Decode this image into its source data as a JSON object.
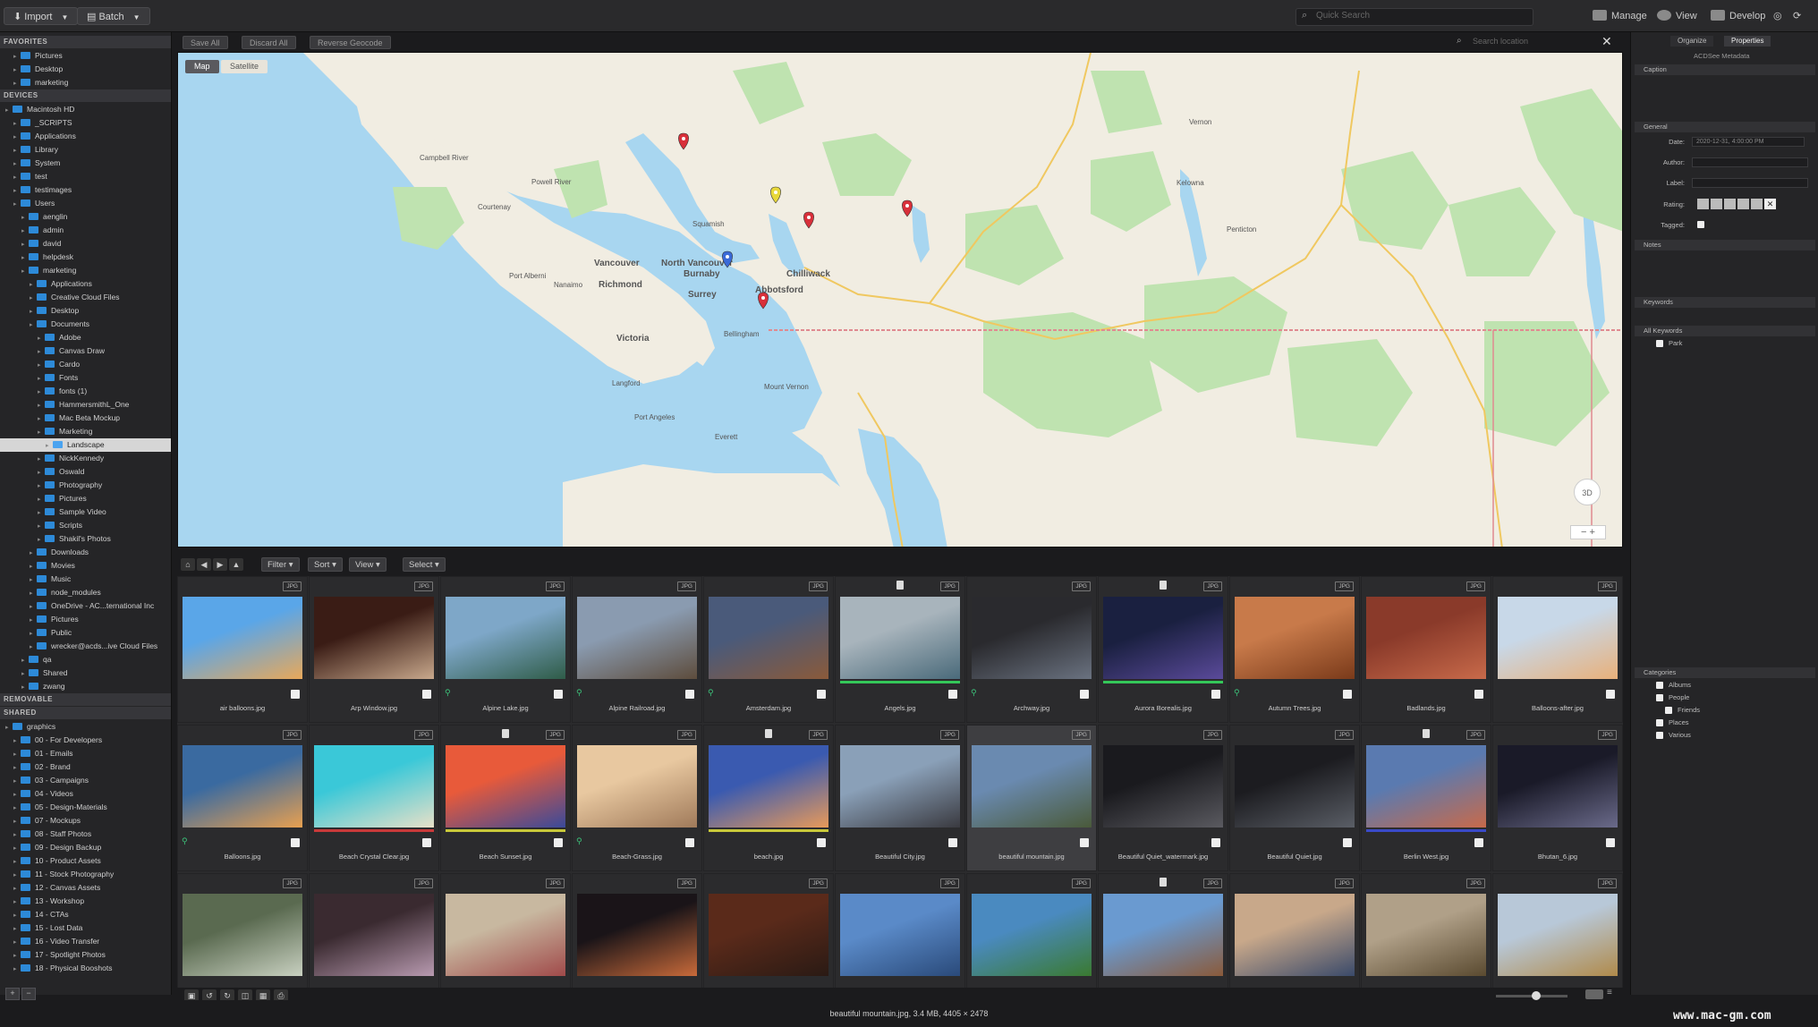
{
  "toolbar": {
    "import_label": "Import",
    "batch_label": "Batch",
    "quick_search_placeholder": "Quick Search",
    "manage_label": "Manage",
    "view_label": "View",
    "develop_label": "Develop"
  },
  "left_panel": {
    "sections": {
      "favorites": "FAVORITES",
      "devices": "DEVICES",
      "removable": "REMOVABLE",
      "shared": "SHARED"
    },
    "favorites": [
      "Pictures",
      "Desktop",
      "marketing"
    ],
    "devices": [
      {
        "label": "Macintosh HD",
        "depth": 0
      },
      {
        "label": "_SCRIPTS",
        "depth": 1
      },
      {
        "label": "Applications",
        "depth": 1
      },
      {
        "label": "Library",
        "depth": 1
      },
      {
        "label": "System",
        "depth": 1
      },
      {
        "label": "test",
        "depth": 1
      },
      {
        "label": "testimages",
        "depth": 1
      },
      {
        "label": "Users",
        "depth": 1
      },
      {
        "label": "aenglin",
        "depth": 2
      },
      {
        "label": "admin",
        "depth": 2
      },
      {
        "label": "david",
        "depth": 2
      },
      {
        "label": "helpdesk",
        "depth": 2
      },
      {
        "label": "marketing",
        "depth": 2
      },
      {
        "label": "Applications",
        "depth": 3
      },
      {
        "label": "Creative Cloud Files",
        "depth": 3
      },
      {
        "label": "Desktop",
        "depth": 3
      },
      {
        "label": "Documents",
        "depth": 3
      },
      {
        "label": "Adobe",
        "depth": 4
      },
      {
        "label": "Canvas Draw",
        "depth": 4
      },
      {
        "label": "Cardo",
        "depth": 4
      },
      {
        "label": "Fonts",
        "depth": 4
      },
      {
        "label": "fonts (1)",
        "depth": 4
      },
      {
        "label": "HammersmithL_One",
        "depth": 4
      },
      {
        "label": "Mac Beta Mockup",
        "depth": 4
      },
      {
        "label": "Marketing",
        "depth": 4
      },
      {
        "label": "Landscape",
        "depth": 5,
        "selected": true
      },
      {
        "label": "NickKennedy",
        "depth": 4
      },
      {
        "label": "Oswald",
        "depth": 4
      },
      {
        "label": "Photography",
        "depth": 4
      },
      {
        "label": "Pictures",
        "depth": 4
      },
      {
        "label": "Sample Video",
        "depth": 4
      },
      {
        "label": "Scripts",
        "depth": 4
      },
      {
        "label": "Shakil's Photos",
        "depth": 4
      },
      {
        "label": "Downloads",
        "depth": 3
      },
      {
        "label": "Movies",
        "depth": 3
      },
      {
        "label": "Music",
        "depth": 3
      },
      {
        "label": "node_modules",
        "depth": 3
      },
      {
        "label": "OneDrive - AC...ternational Inc",
        "depth": 3
      },
      {
        "label": "Pictures",
        "depth": 3
      },
      {
        "label": "Public",
        "depth": 3
      },
      {
        "label": "wrecker@acds...ive Cloud Files",
        "depth": 3
      },
      {
        "label": "qa",
        "depth": 2
      },
      {
        "label": "Shared",
        "depth": 2
      },
      {
        "label": "zwang",
        "depth": 2
      }
    ],
    "shared": [
      {
        "label": "graphics",
        "depth": 0
      },
      {
        "label": "00 - For Developers",
        "depth": 1
      },
      {
        "label": "01 - Emails",
        "depth": 1
      },
      {
        "label": "02 - Brand",
        "depth": 1
      },
      {
        "label": "03 - Campaigns",
        "depth": 1
      },
      {
        "label": "04 - Videos",
        "depth": 1
      },
      {
        "label": "05 - Design-Materials",
        "depth": 1
      },
      {
        "label": "07 - Mockups",
        "depth": 1
      },
      {
        "label": "08 - Staff Photos",
        "depth": 1
      },
      {
        "label": "09 - Design Backup",
        "depth": 1
      },
      {
        "label": "10 - Product Assets",
        "depth": 1
      },
      {
        "label": "11 - Stock Photography",
        "depth": 1
      },
      {
        "label": "12 - Canvas Assets",
        "depth": 1
      },
      {
        "label": "13 - Workshop",
        "depth": 1
      },
      {
        "label": "14 - CTAs",
        "depth": 1
      },
      {
        "label": "15 - Lost Data",
        "depth": 1
      },
      {
        "label": "16 - Video Transfer",
        "depth": 1
      },
      {
        "label": "17 - Spotlight Photos",
        "depth": 1
      },
      {
        "label": "18 - Physical Booshots",
        "depth": 1
      }
    ]
  },
  "map_toolbar": {
    "save_all": "Save All",
    "discard_all": "Discard All",
    "reverse_geocode": "Reverse Geocode",
    "search_placeholder": "Search location"
  },
  "map": {
    "tab_map": "Map",
    "tab_satellite": "Satellite",
    "labels": [
      {
        "text": "Vancouver"
      },
      {
        "text": "North Vancouver"
      },
      {
        "text": "Burnaby"
      },
      {
        "text": "Richmond"
      },
      {
        "text": "Surrey"
      },
      {
        "text": "Abbotsford"
      },
      {
        "text": "Chilliwack"
      },
      {
        "text": "Victoria"
      },
      {
        "text": "Nanaimo"
      },
      {
        "text": "Port Alberni"
      },
      {
        "text": "Campbell River"
      },
      {
        "text": "Powell River"
      },
      {
        "text": "Kelowna"
      },
      {
        "text": "Bellingham"
      },
      {
        "text": "Everett"
      },
      {
        "text": "Mount Vernon"
      },
      {
        "text": "Port Angeles"
      },
      {
        "text": "Penticton"
      },
      {
        "text": "Vernon"
      },
      {
        "text": "Courtenay"
      },
      {
        "text": "Squamish"
      },
      {
        "text": "Langford"
      }
    ],
    "compass_label": "3D"
  },
  "film_toolbar": {
    "filter": "Filter",
    "sort": "Sort",
    "view": "View",
    "select": "Select"
  },
  "thumbnails": [
    {
      "name": "air balloons.jpg",
      "badge": "JPG",
      "colors": [
        "#5aa6e8",
        "#e8a85a"
      ]
    },
    {
      "name": "Arp Window.jpg",
      "badge": "JPG",
      "colors": [
        "#3a1c15",
        "#c8a88c"
      ]
    },
    {
      "name": "Alpine Lake.jpg",
      "badge": "JPG",
      "colors": [
        "#7ea7c8",
        "#2f5c48"
      ],
      "pin": true
    },
    {
      "name": "Alpine Railroad.jpg",
      "badge": "JPG",
      "colors": [
        "#8a9bb0",
        "#5d4c3c"
      ],
      "pin": true
    },
    {
      "name": "Amsterdam.jpg",
      "badge": "JPG",
      "colors": [
        "#4a5a7a",
        "#8a5a3a"
      ],
      "pin": true
    },
    {
      "name": "Angels.jpg",
      "badge": "JPG",
      "colors": [
        "#a8b4bc",
        "#4a6a7a"
      ],
      "page": true,
      "bar": "#34c759"
    },
    {
      "name": "Archway.jpg",
      "badge": "JPG",
      "colors": [
        "#2a2a2e",
        "#6a7280"
      ],
      "pin": true
    },
    {
      "name": "Aurora Borealis.jpg",
      "badge": "JPG",
      "colors": [
        "#1a2040",
        "#5a4a9a"
      ],
      "page": true,
      "bar": "#34c759"
    },
    {
      "name": "Autumn Trees.jpg",
      "badge": "JPG",
      "colors": [
        "#c87a4a",
        "#7a3a1a"
      ],
      "pin": true
    },
    {
      "name": "Badlands.jpg",
      "badge": "JPG",
      "colors": [
        "#8a3a2a",
        "#c86a4a"
      ]
    },
    {
      "name": "Balloons-after.jpg",
      "badge": "JPG",
      "colors": [
        "#c8d8e8",
        "#e8b07a"
      ]
    },
    {
      "name": "Balloons.jpg",
      "badge": "JPG",
      "colors": [
        "#3a6aa0",
        "#e8a050"
      ],
      "pin": true
    },
    {
      "name": "Beach Crystal Clear.jpg",
      "badge": "JPG",
      "colors": [
        "#3ac8d8",
        "#e8e0c8"
      ],
      "bar": "#c83a3a"
    },
    {
      "name": "Beach Sunset.jpg",
      "badge": "JPG",
      "colors": [
        "#e85a3a",
        "#3a4a9a"
      ],
      "page": true,
      "bar": "#c8c83a"
    },
    {
      "name": "Beach-Grass.jpg",
      "badge": "JPG",
      "colors": [
        "#e8c8a0",
        "#a07a5a"
      ],
      "pin": true
    },
    {
      "name": "beach.jpg",
      "badge": "JPG",
      "colors": [
        "#3a5ab0",
        "#e89a5a"
      ],
      "page": true,
      "bar": "#c8c83a"
    },
    {
      "name": "Beautiful City.jpg",
      "badge": "JPG",
      "colors": [
        "#8aa0b8",
        "#3a3a40"
      ]
    },
    {
      "name": "beautiful mountain.jpg",
      "badge": "JPG",
      "colors": [
        "#6a8ab0",
        "#4a5a3a"
      ],
      "selected": true
    },
    {
      "name": "Beautiful Quiet_watermark.jpg",
      "badge": "JPG",
      "colors": [
        "#1a1a1e",
        "#5a5a60"
      ]
    },
    {
      "name": "Beautiful Quiet.jpg",
      "badge": "JPG",
      "colors": [
        "#1c1c20",
        "#5a5e66"
      ]
    },
    {
      "name": "Berlin West.jpg",
      "badge": "JPG",
      "colors": [
        "#5a7ab0",
        "#c86a4a"
      ],
      "page": true,
      "bar": "#3a4ac8"
    },
    {
      "name": "Bhutan_6.jpg",
      "badge": "JPG",
      "colors": [
        "#1a1a28",
        "#6a6a8a"
      ]
    },
    {
      "name": "",
      "badge": "JPG",
      "colors": [
        "#5a6a50",
        "#c8d0c0"
      ]
    },
    {
      "name": "",
      "badge": "JPG",
      "colors": [
        "#3a2a30",
        "#b89ab0"
      ]
    },
    {
      "name": "",
      "badge": "JPG",
      "colors": [
        "#c8b8a0",
        "#a04a4a"
      ]
    },
    {
      "name": "",
      "badge": "JPG",
      "colors": [
        "#1a1418",
        "#c86a3a"
      ]
    },
    {
      "name": "",
      "badge": "JPG",
      "colors": [
        "#5a2a1a",
        "#2a1a14"
      ]
    },
    {
      "name": "",
      "badge": "JPG",
      "colors": [
        "#5a8ac8",
        "#2a4a7a"
      ]
    },
    {
      "name": "",
      "badge": "JPG",
      "colors": [
        "#4a8ac0",
        "#3a7a30"
      ]
    },
    {
      "name": "",
      "badge": "JPG",
      "colors": [
        "#6a9ad0",
        "#8a5a3a"
      ],
      "page": true
    },
    {
      "name": "",
      "badge": "JPG",
      "colors": [
        "#c8a88a",
        "#3a4a6a"
      ]
    },
    {
      "name": "",
      "badge": "JPG",
      "colors": [
        "#b0a088",
        "#5a4a30"
      ]
    },
    {
      "name": "",
      "badge": "JPG",
      "colors": [
        "#b8c8d8",
        "#b08a4a"
      ]
    }
  ],
  "right_panel": {
    "tab_organize": "Organize",
    "tab_properties": "Properties",
    "metadata_title": "ACDSee Metadata",
    "caption": "Caption",
    "general": "General",
    "date_label": "Date:",
    "date_value": "2020-12-31, 4:00:00 PM",
    "author_label": "Author:",
    "label_label": "Label:",
    "rating_label": "Rating:",
    "tagged_label": "Tagged:",
    "notes": "Notes",
    "keywords": "Keywords",
    "all_keywords": "All Keywords",
    "keyword_park": "Park",
    "categories": "Categories",
    "cat_albums": "Albums",
    "cat_people": "People",
    "cat_friends": "Friends",
    "cat_places": "Places",
    "cat_various": "Various"
  },
  "status": {
    "text": "beautiful mountain.jpg, 3.4 MB, 4405 × 2478",
    "watermark": "www.mac-gm.com"
  },
  "colors": {
    "accent": "#2d8ad8",
    "water": "#a8d6f0",
    "park": "#bfe3b0",
    "pin_red": "#d8303a",
    "pin_blue": "#3a6ad8",
    "pin_yellow": "#e8d83a"
  }
}
